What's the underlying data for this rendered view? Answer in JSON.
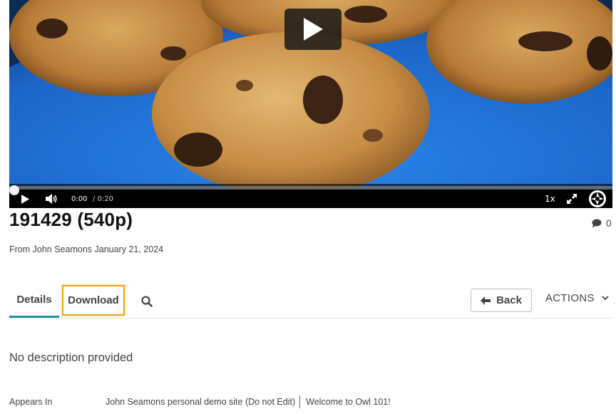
{
  "player": {
    "current_time": "0:00",
    "duration": "/ 0:20",
    "speed": "1x",
    "progress": 0
  },
  "media": {
    "title": "191429 (540p)",
    "byline": "From John Seamons January 21, 2024",
    "comment_count": "0"
  },
  "tabs": [
    {
      "label": "Details",
      "active": true
    },
    {
      "label": "Download",
      "highlighted": true
    }
  ],
  "toolbar": {
    "back_label": "Back",
    "actions_label": "ACTIONS"
  },
  "details": {
    "description": "No description provided",
    "appears_in_label": "Appears In",
    "appears_in": [
      "John Seamons personal demo site (Do not Edit)",
      "Welcome to Owl 101!"
    ]
  },
  "colors": {
    "tab_underline": "#1e93a6",
    "highlight_outline": "#f0a21a",
    "plate_blue": "#1f6fd6"
  },
  "icons": [
    "play-icon",
    "volume-icon",
    "fullscreen-icon",
    "kaltura-logo-icon",
    "comment-icon",
    "search-icon",
    "arrow-left-icon",
    "chevron-down-icon"
  ]
}
